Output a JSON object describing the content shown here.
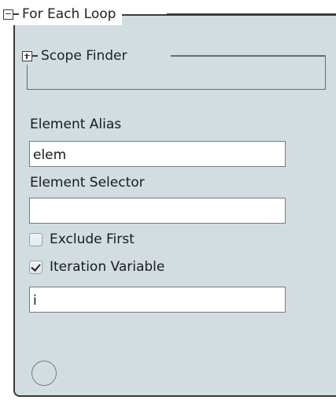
{
  "for_each_loop": {
    "title": "For Each Loop",
    "collapse_icon": "minus-box-icon"
  },
  "scope_finder": {
    "title": "Scope Finder",
    "expand_icon": "plus-box-icon"
  },
  "element_alias": {
    "label": "Element Alias",
    "value": "elem"
  },
  "element_selector": {
    "label": "Element Selector",
    "value": ""
  },
  "exclude_first": {
    "label": "Exclude First",
    "checked": false
  },
  "iteration_variable": {
    "label": "Iteration Variable",
    "checked": true,
    "value": "i"
  },
  "colors": {
    "panel_background": "#d1dde1",
    "border": "#3a3a3a"
  }
}
